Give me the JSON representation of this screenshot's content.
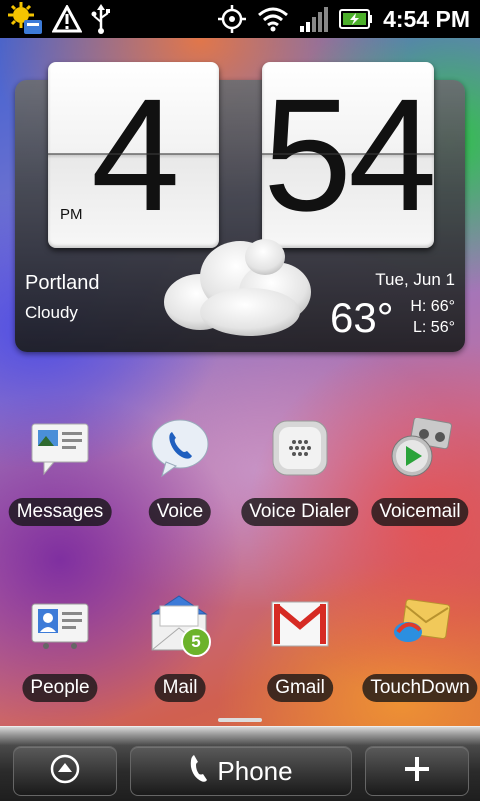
{
  "status_bar": {
    "time": "4:54 PM",
    "icons": [
      "weather-update-icon",
      "warning-icon",
      "usb-icon",
      "gps-icon",
      "wifi-icon",
      "signal-icon",
      "battery-charging-icon"
    ]
  },
  "clock_widget": {
    "hours": "4",
    "minutes": "54",
    "ampm": "PM",
    "city": "Portland",
    "condition": "Cloudy",
    "date": "Tue, Jun 1",
    "temperature": "63°",
    "high": "H: 66°",
    "low": "L: 56°"
  },
  "apps": {
    "messages": "Messages",
    "voice": "Voice",
    "voice_dialer": "Voice Dialer",
    "voicemail": "Voicemail",
    "people": "People",
    "mail": "Mail",
    "mail_badge": "5",
    "gmail": "Gmail",
    "touchdown": "TouchDown"
  },
  "dock": {
    "phone_label": "Phone"
  },
  "colors": {
    "statusbar_bg": "#000000",
    "battery_green": "#4caf2a",
    "mail_badge_green": "#6cb32a",
    "gmail_red": "#d62b24"
  }
}
